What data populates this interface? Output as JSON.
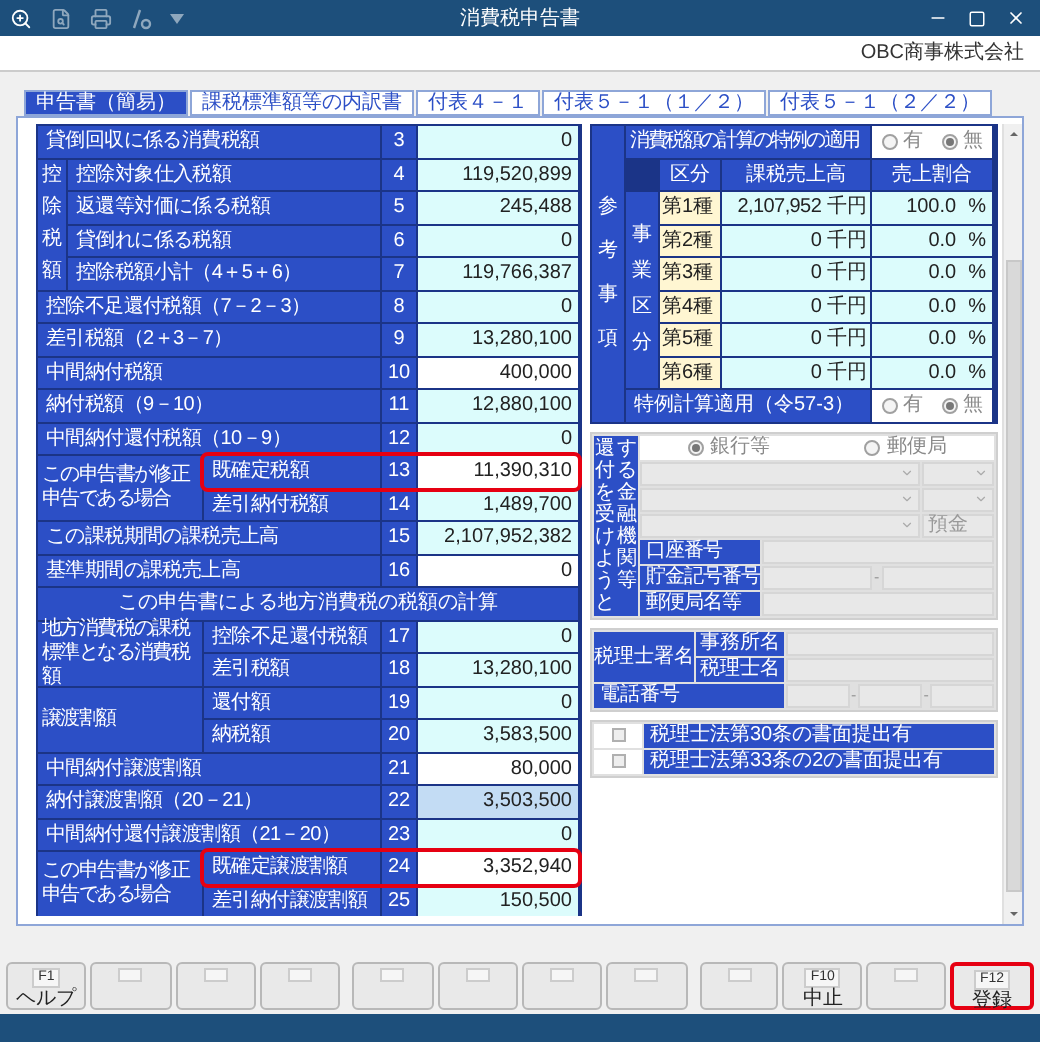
{
  "window": {
    "title": "消費税申告書"
  },
  "company": "OBC商事株式会社",
  "tabs": [
    {
      "label": "申告書（簡易）",
      "selected": true
    },
    {
      "label": "課税標準額等の内訳書",
      "selected": false
    },
    {
      "label": "付表４－１",
      "selected": false
    },
    {
      "label": "付表５－１（１／２）",
      "selected": false
    },
    {
      "label": "付表５－１（２／２）",
      "selected": false
    }
  ],
  "main_form": [
    {
      "kind": "single",
      "label": "貸倒回収に係る消費税額",
      "no": "3",
      "value": "0",
      "editable": false,
      "selected": false,
      "highlighted": false
    },
    {
      "kind": "vgroup",
      "label": "控除税額",
      "rows": [
        {
          "label": "控除対象仕入税額",
          "no": "4",
          "value": "119,520,899",
          "editable": false,
          "selected": false,
          "highlighted": false
        },
        {
          "label": "返還等対価に係る税額",
          "no": "5",
          "value": "245,488",
          "editable": false,
          "selected": false,
          "highlighted": false
        },
        {
          "label": "貸倒れに係る税額",
          "no": "6",
          "value": "0",
          "editable": false,
          "selected": false,
          "highlighted": false
        },
        {
          "label": "控除税額小計（4＋5＋6）",
          "no": "7",
          "value": "119,766,387",
          "editable": false,
          "selected": false,
          "highlighted": false
        }
      ]
    },
    {
      "kind": "single",
      "label": "控除不足還付税額（7－2－3）",
      "no": "8",
      "value": "0",
      "editable": false,
      "selected": false,
      "highlighted": false
    },
    {
      "kind": "single",
      "label": "差引税額（2＋3－7）",
      "no": "9",
      "value": "13,280,100",
      "editable": false,
      "selected": false,
      "highlighted": false
    },
    {
      "kind": "single",
      "label": "中間納付税額",
      "no": "10",
      "value": "400,000",
      "editable": true,
      "selected": false,
      "highlighted": false
    },
    {
      "kind": "single",
      "label": "納付税額（9－10）",
      "no": "11",
      "value": "12,880,100",
      "editable": false,
      "selected": false,
      "highlighted": false
    },
    {
      "kind": "single",
      "label": "中間納付還付税額（10－9）",
      "no": "12",
      "value": "0",
      "editable": false,
      "selected": false,
      "highlighted": false
    },
    {
      "kind": "group",
      "label": "この申告書が修正申告である場合",
      "rows": [
        {
          "label": "既確定税額",
          "no": "13",
          "value": "11,390,310",
          "editable": true,
          "selected": false,
          "highlighted": true
        },
        {
          "label": "差引納付税額",
          "no": "14",
          "value": "1,489,700",
          "editable": false,
          "selected": false,
          "highlighted": false
        }
      ]
    },
    {
      "kind": "single",
      "label": "この課税期間の課税売上高",
      "no": "15",
      "value": "2,107,952,382",
      "editable": false,
      "selected": false,
      "highlighted": false
    },
    {
      "kind": "single",
      "label": "基準期間の課税売上高",
      "no": "16",
      "value": "0",
      "editable": true,
      "selected": false,
      "highlighted": false
    },
    {
      "kind": "heading",
      "label": "この申告書による地方消費税の税額の計算"
    },
    {
      "kind": "group",
      "label": "地方消費税の課税標準となる消費税額",
      "rows": [
        {
          "label": "控除不足還付税額",
          "no": "17",
          "value": "0",
          "editable": false,
          "selected": false,
          "highlighted": false
        },
        {
          "label": "差引税額",
          "no": "18",
          "value": "13,280,100",
          "editable": false,
          "selected": false,
          "highlighted": false
        }
      ]
    },
    {
      "kind": "group",
      "label": "譲渡割額",
      "rows": [
        {
          "label": "還付額",
          "no": "19",
          "value": "0",
          "editable": false,
          "selected": false,
          "highlighted": false
        },
        {
          "label": "納税額",
          "no": "20",
          "value": "3,583,500",
          "editable": false,
          "selected": false,
          "highlighted": false
        }
      ]
    },
    {
      "kind": "single",
      "label": "中間納付譲渡割額",
      "no": "21",
      "value": "80,000",
      "editable": true,
      "selected": false,
      "highlighted": false
    },
    {
      "kind": "single",
      "label": "納付譲渡割額（20－21）",
      "no": "22",
      "value": "3,503,500",
      "editable": false,
      "selected": true,
      "highlighted": false
    },
    {
      "kind": "single",
      "label": "中間納付還付譲渡割額（21－20）",
      "no": "23",
      "value": "0",
      "editable": false,
      "selected": false,
      "highlighted": false
    },
    {
      "kind": "group",
      "label": "この申告書が修正申告である場合",
      "rows": [
        {
          "label": "既確定譲渡割額",
          "no": "24",
          "value": "3,352,940",
          "editable": true,
          "selected": false,
          "highlighted": true
        },
        {
          "label": "差引納付譲渡割額",
          "no": "25",
          "value": "150,500",
          "editable": false,
          "selected": false,
          "highlighted": false
        }
      ]
    }
  ],
  "reference": {
    "label": "参考事項",
    "special_rule": {
      "label": "消費税額の計算の特例の適用",
      "options": [
        {
          "label": "有",
          "selected": false
        },
        {
          "label": "無",
          "selected": true
        }
      ]
    },
    "business_label": "事業区分",
    "headers": [
      "区分",
      "課税売上高",
      "売上割合"
    ],
    "rows": [
      {
        "category": "第1種",
        "sales": "2,107,952",
        "sales_unit": "千円",
        "ratio": "100.0",
        "ratio_unit": "%"
      },
      {
        "category": "第2種",
        "sales": "0",
        "sales_unit": "千円",
        "ratio": "0.0",
        "ratio_unit": "%"
      },
      {
        "category": "第3種",
        "sales": "0",
        "sales_unit": "千円",
        "ratio": "0.0",
        "ratio_unit": "%"
      },
      {
        "category": "第4種",
        "sales": "0",
        "sales_unit": "千円",
        "ratio": "0.0",
        "ratio_unit": "%"
      },
      {
        "category": "第5種",
        "sales": "0",
        "sales_unit": "千円",
        "ratio": "0.0",
        "ratio_unit": "%"
      },
      {
        "category": "第6種",
        "sales": "0",
        "sales_unit": "千円",
        "ratio": "0.0",
        "ratio_unit": "%"
      }
    ],
    "calc_rule": {
      "label": "特例計算適用（令57-3）",
      "options": [
        {
          "label": "有",
          "selected": false
        },
        {
          "label": "無",
          "selected": true
        }
      ]
    }
  },
  "refund": {
    "label": "還付を受けようとする金融機関等",
    "options": [
      {
        "label": "銀行等",
        "selected": true
      },
      {
        "label": "郵便局",
        "selected": false
      }
    ],
    "deposit_type": "預金",
    "account_number": "口座番号",
    "savings_number": {
      "label": "貯金記号番号",
      "separator": "-"
    },
    "post_office": "郵便局名等"
  },
  "tax_accountant": {
    "label": "税理士署名",
    "office": "事務所名",
    "name": "税理士名",
    "phone": {
      "label": "電話番号",
      "separators": [
        "-",
        "-"
      ]
    }
  },
  "documents": [
    {
      "label": "税理士法第30条の書面提出有",
      "checked": false
    },
    {
      "label": "税理士法第33条の2の書面提出有",
      "checked": false
    }
  ],
  "function_keys": [
    {
      "kind": "key",
      "key": "F1",
      "label": "ヘルプ",
      "highlighted": false
    },
    {
      "kind": "blank",
      "highlighted": false
    },
    {
      "kind": "blank",
      "highlighted": false
    },
    {
      "kind": "blank",
      "highlighted": false
    },
    {
      "kind": "blank",
      "highlighted": false
    },
    {
      "kind": "blank",
      "highlighted": false
    },
    {
      "kind": "blank",
      "highlighted": false
    },
    {
      "kind": "blank",
      "highlighted": false
    },
    {
      "kind": "blank",
      "highlighted": false
    },
    {
      "kind": "key",
      "key": "F10",
      "label": "中止",
      "highlighted": false
    },
    {
      "kind": "blank",
      "highlighted": false
    },
    {
      "kind": "key",
      "key": "F12",
      "label": "登録",
      "highlighted": true
    }
  ]
}
